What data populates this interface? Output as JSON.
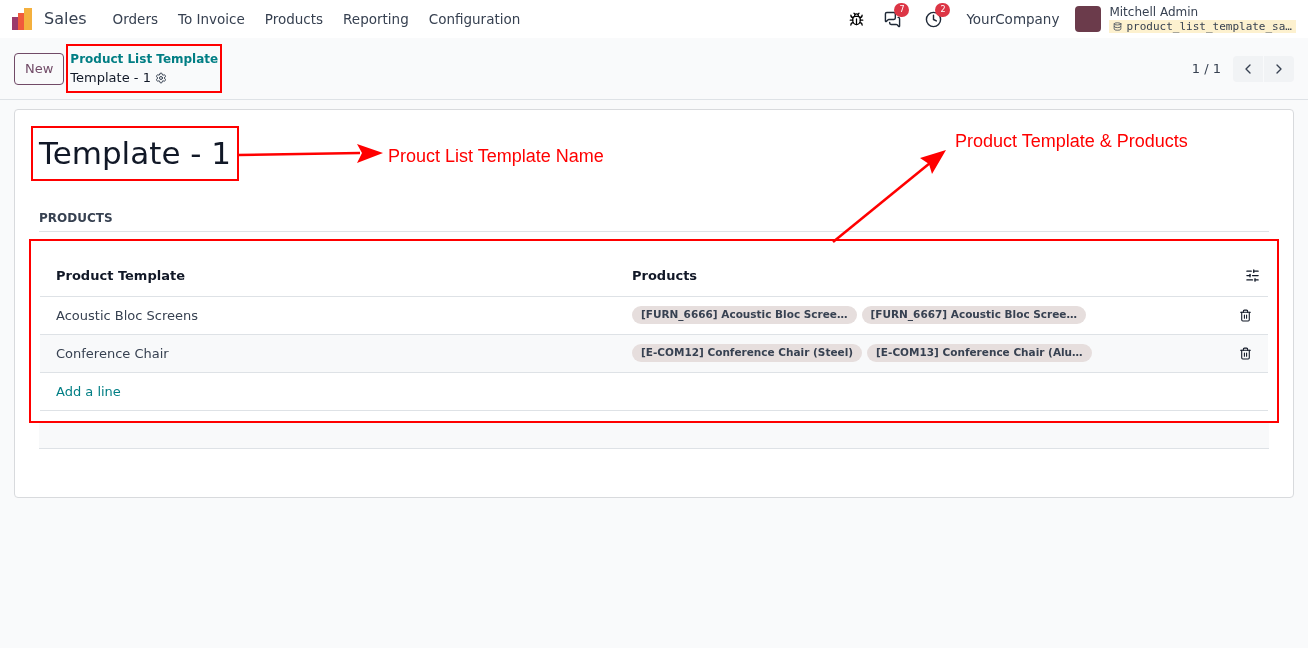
{
  "navbar": {
    "app_name": "Sales",
    "menu": [
      "Orders",
      "To Invoice",
      "Products",
      "Reporting",
      "Configuration"
    ],
    "messages_count": "7",
    "activities_count": "2",
    "company": "YourCompany",
    "user_name": "Mitchell Admin",
    "database": "product_list_template_sa…"
  },
  "control_panel": {
    "new_button": "New",
    "breadcrumb_parent": "Product List Template",
    "breadcrumb_current": "Template - 1",
    "pager": "1 / 1"
  },
  "form": {
    "title": "Template - 1",
    "section": "PRODUCTS",
    "table": {
      "columns": [
        "Product Template",
        "Products"
      ],
      "rows": [
        {
          "template": "Acoustic Bloc Screens",
          "products": [
            "[FURN_6666] Acoustic Bloc Scree…",
            "[FURN_6667] Acoustic Bloc Scree…"
          ]
        },
        {
          "template": "Conference Chair",
          "products": [
            "[E-COM12] Conference Chair (Steel)",
            "[E-COM13] Conference Chair (Alu…"
          ]
        }
      ],
      "add_line": "Add a line"
    }
  },
  "annotations": [
    {
      "text": "Prouct List Template Name"
    },
    {
      "text": "Product Template & Products"
    }
  ]
}
